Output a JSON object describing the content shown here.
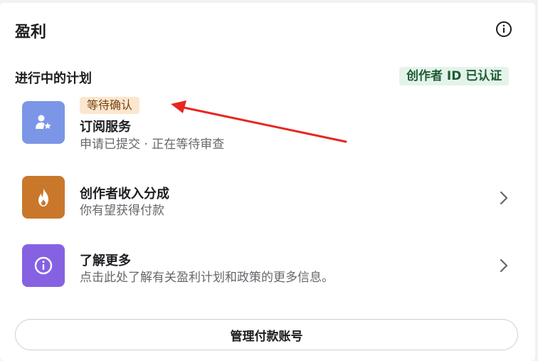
{
  "header": {
    "title": "盈利",
    "info_icon": "info-circle-icon"
  },
  "section": {
    "label": "进行中的计划",
    "verified_badge": "创作者 ID 已认证"
  },
  "items": [
    {
      "badge": "等待确认",
      "title": "订阅服务",
      "subtitle": "申请已提交 · 正在等待审查",
      "icon": "person-star-icon",
      "icon_color": "#7b96e6"
    },
    {
      "title": "创作者收入分成",
      "subtitle": "你有望获得付款",
      "icon": "flame-icon",
      "icon_color": "#c9782b"
    },
    {
      "title": "了解更多",
      "subtitle": "点击此处了解有关盈利计划和政策的更多信息。",
      "icon": "info-icon",
      "icon_color": "#8662e3"
    }
  ],
  "footer": {
    "manage_button": "管理付款账号"
  },
  "annotation_color": "#e8261f"
}
